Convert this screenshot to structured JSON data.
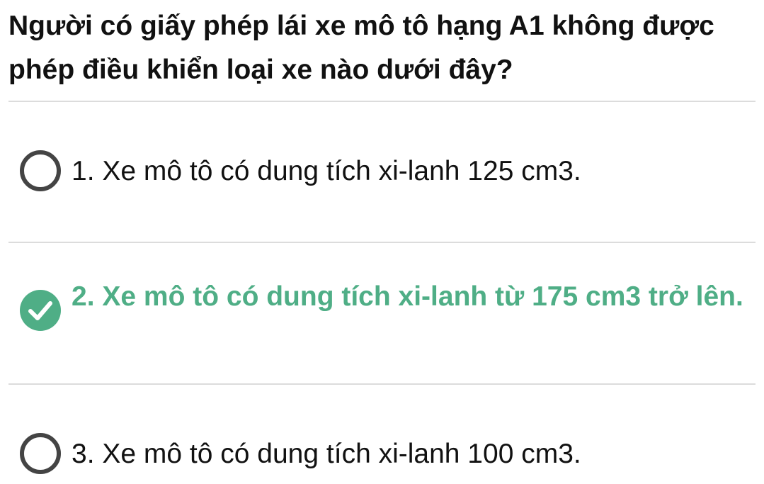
{
  "question": {
    "text": "Người có giấy phép lái xe mô tô hạng A1 không được phép điều khiển loại xe nào dưới đây?"
  },
  "options": [
    {
      "label": "1. Xe mô tô có dung tích xi-lanh 125 cm3.",
      "selected": false,
      "correct": false
    },
    {
      "label": "2. Xe mô tô có dung tích xi-lanh từ 175 cm3 trở lên.",
      "selected": true,
      "correct": true
    },
    {
      "label": "3. Xe mô tô có dung tích xi-lanh 100 cm3.",
      "selected": false,
      "correct": false
    }
  ],
  "colors": {
    "correct": "#4fae86",
    "text": "#111111",
    "radio_border": "#444444",
    "divider": "#dcdcdc"
  },
  "icons": {
    "unchecked": "radio-unchecked-icon",
    "checked": "check-circle-icon"
  }
}
